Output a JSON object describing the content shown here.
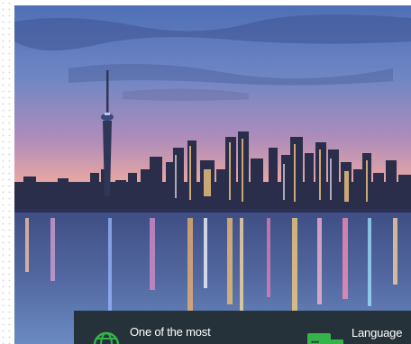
{
  "banner": {
    "feature_1": {
      "icon": "globe-icon",
      "label": "One of the most"
    },
    "feature_2": {
      "icon": "translate-icon",
      "label": "Language"
    }
  },
  "colors": {
    "banner_bg": "#263239",
    "icon_green": "#35b44a"
  }
}
